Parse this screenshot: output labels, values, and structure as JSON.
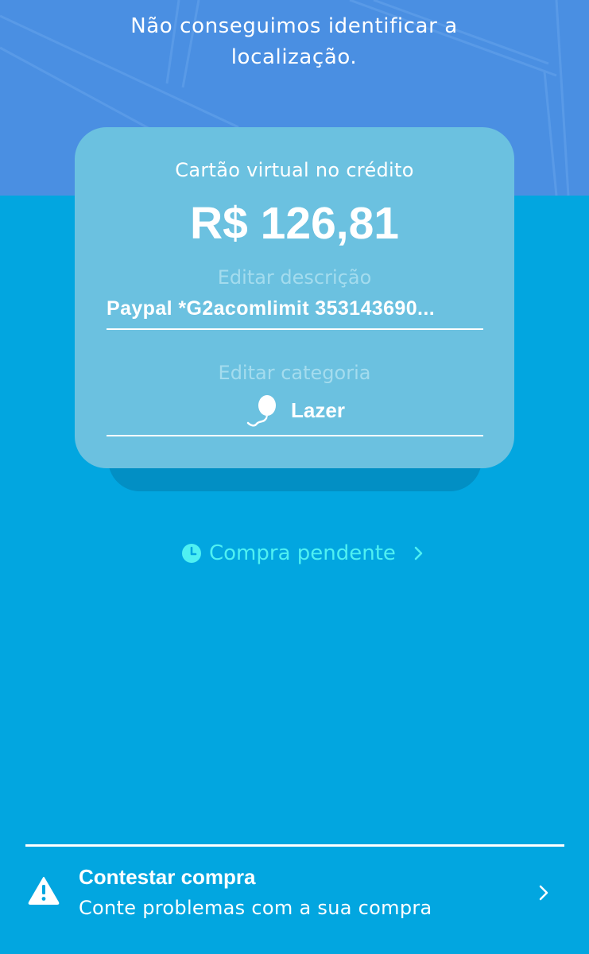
{
  "header": {
    "location_message": "Não conseguimos identificar a localização."
  },
  "card": {
    "type_label": "Cartão virtual no crédito",
    "amount": "R$ 126,81",
    "edit_description_label": "Editar descrição",
    "description_value": "Paypal *G2acomlimit 353143690...",
    "edit_category_label": "Editar categoria",
    "category_value": "Lazer",
    "category_icon": "balloon-icon"
  },
  "status": {
    "label": "Compra pendente",
    "icon": "clock-icon"
  },
  "contest": {
    "title": "Contestar compra",
    "subtitle": "Conte problemas com a sua compra",
    "icon": "warning-icon"
  },
  "colors": {
    "header_bg": "#4a8fe2",
    "page_bg": "#02a6e0",
    "card_bg": "#6bc1e0",
    "status_accent": "#4ff0f2"
  }
}
